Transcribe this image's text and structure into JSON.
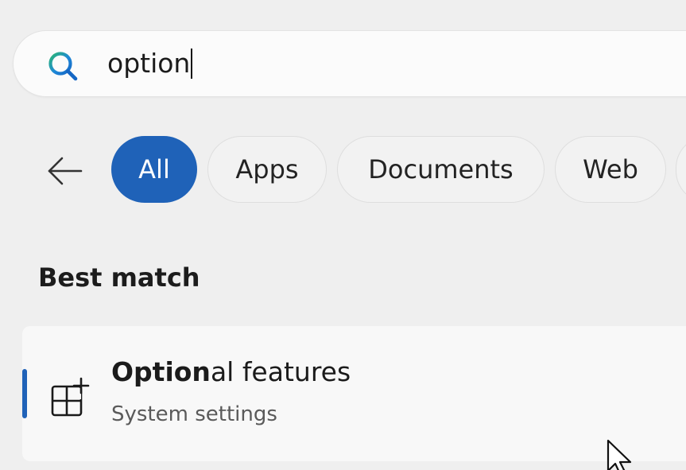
{
  "search": {
    "query": "option"
  },
  "filters": {
    "back_icon": "arrow-left-icon",
    "chips": [
      {
        "label": "All",
        "selected": true
      },
      {
        "label": "Apps",
        "selected": false
      },
      {
        "label": "Documents",
        "selected": false
      },
      {
        "label": "Web",
        "selected": false
      }
    ]
  },
  "best_match": {
    "heading": "Best match",
    "result": {
      "title_bold": "Option",
      "title_rest": "al features",
      "subtitle": "System settings",
      "icon": "optional-features-icon"
    }
  },
  "colors": {
    "accent": "#1f62b8",
    "background": "#efefef"
  }
}
